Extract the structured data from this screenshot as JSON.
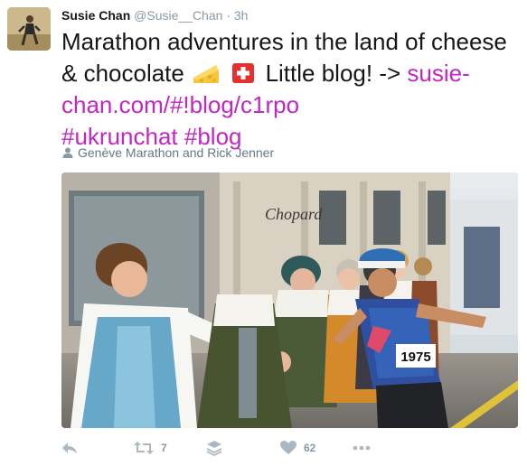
{
  "tweet": {
    "author_name": "Susie Chan",
    "author_handle": "@Susie__Chan",
    "separator": "·",
    "time": "3h",
    "text_part1": "Marathon adventures in the land of cheese & chocolate",
    "text_part2": " Little blog! -> ",
    "link": "susie-chan.com/#!blog/c1rpo",
    "hashtag1": "#ukrunchat",
    "hashtag2": "#blog",
    "tagged_people": "Genève Marathon and Rick Jenner",
    "photo_sign": "Chopard",
    "runner_bib": "1975",
    "emoji_1": "cheese-wedge-emoji",
    "emoji_2": "swiss-flag-emoji"
  },
  "actions": {
    "reply_icon": "reply-icon",
    "retweet_icon": "retweet-icon",
    "retweet_count": "7",
    "stack_icon": "stack-icon",
    "like_icon": "heart-icon",
    "like_count": "62",
    "more_icon": "more-dots-icon"
  },
  "colors": {
    "link": "#c227c2",
    "muted": "#8899a6",
    "icon": "#aab8c2",
    "text": "#14171a"
  }
}
